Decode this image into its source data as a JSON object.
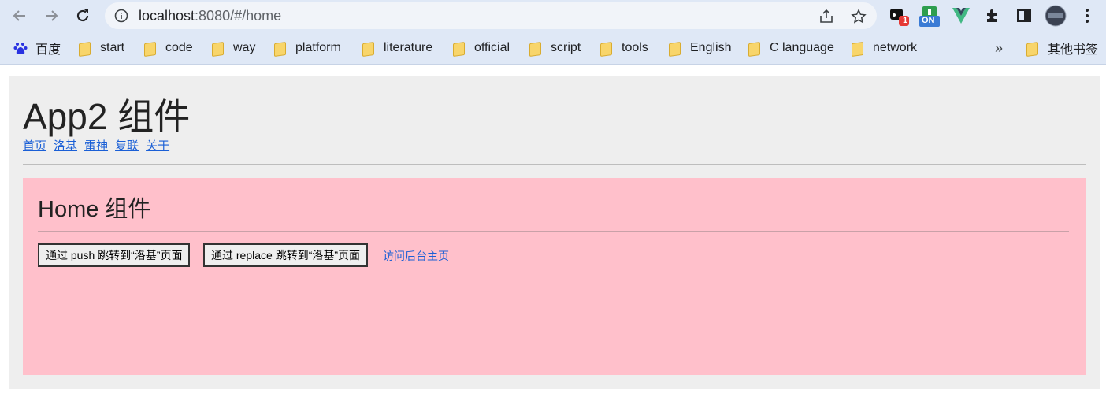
{
  "browser": {
    "url_host": "localhost",
    "url_rest": ":8080/#/home",
    "extensions": {
      "ext1_badge": "1",
      "ext2_badge": "ON"
    },
    "bookmarks": [
      {
        "label": "百度",
        "icon": "baidu-icon"
      },
      {
        "label": "start",
        "icon": "folder-icon"
      },
      {
        "label": "code",
        "icon": "folder-icon"
      },
      {
        "label": "way",
        "icon": "folder-icon"
      },
      {
        "label": "platform",
        "icon": "folder-icon"
      },
      {
        "label": "literature",
        "icon": "folder-icon"
      },
      {
        "label": "official",
        "icon": "folder-icon"
      },
      {
        "label": "script",
        "icon": "folder-icon"
      },
      {
        "label": "tools",
        "icon": "folder-icon"
      },
      {
        "label": "English",
        "icon": "folder-icon"
      },
      {
        "label": "C language",
        "icon": "folder-icon"
      },
      {
        "label": "network",
        "icon": "folder-icon"
      }
    ],
    "more_bookmarks": "»",
    "other_bookmarks": "其他书签"
  },
  "app": {
    "title": "App2 组件",
    "nav": [
      "首页",
      "洛基",
      "雷神",
      "复联",
      "关于"
    ]
  },
  "home": {
    "title": "Home 组件",
    "push_button": "通过 push 跳转到“洛基”页面",
    "replace_button": "通过 replace 跳转到“洛基”页面",
    "admin_link": "访问后台主页"
  },
  "colors": {
    "chrome_bg": "#dfe8f6",
    "page_bg": "#eeeeee",
    "home_bg": "#ffc0cb",
    "link": "#1a5fd6"
  }
}
